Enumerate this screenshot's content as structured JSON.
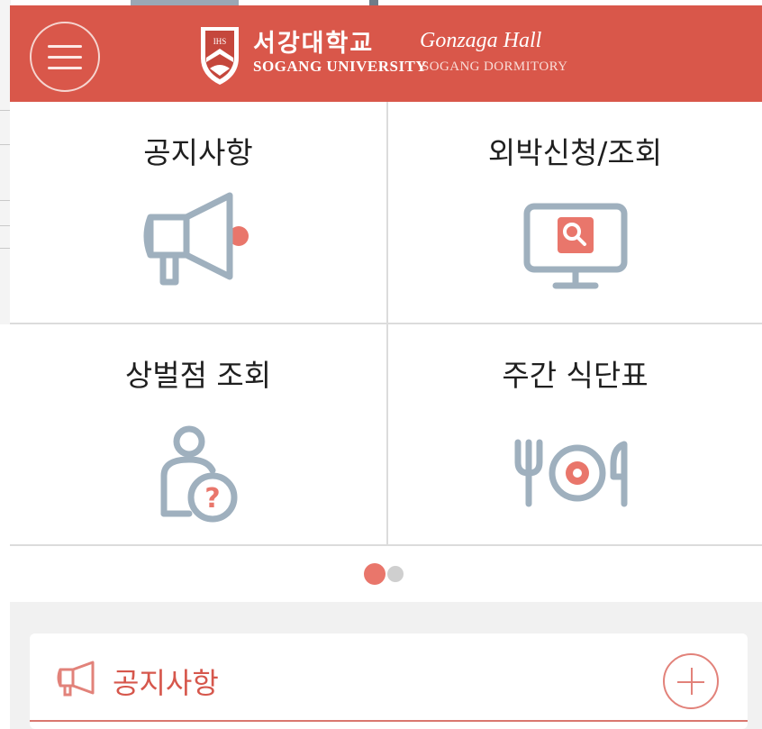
{
  "header": {
    "university_korean": "서강대학교",
    "university_english": "SOGANG UNIVERSITY",
    "hall_name": "Gonzaga Hall",
    "hall_subtitle": "SOGANG DORMITORY",
    "crest_text": "IHS",
    "brand_color": "#d9574a"
  },
  "menu": {
    "tiles": [
      {
        "label": "공지사항",
        "icon": "megaphone-icon"
      },
      {
        "label": "외박신청/조회",
        "icon": "monitor-search-icon"
      },
      {
        "label": "상벌점 조회",
        "icon": "person-question-icon"
      },
      {
        "label": "주간 식단표",
        "icon": "fork-plate-spoon-icon"
      }
    ]
  },
  "pager": {
    "pages": 2,
    "current": 1
  },
  "notice": {
    "title": "공지사항",
    "icon": "megaphone-outline-icon",
    "add_icon": "plus-circle-icon"
  },
  "colors": {
    "accent": "#e9766b",
    "icon_gray": "#9fb0be",
    "text": "#1f1f1f"
  }
}
